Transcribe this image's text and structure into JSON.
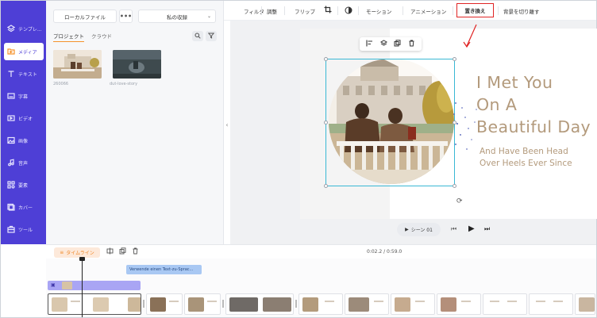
{
  "rail": {
    "items": [
      {
        "label": "テンプレ...",
        "icon": "layers-icon"
      },
      {
        "label": "メディア",
        "icon": "media-folder-icon"
      },
      {
        "label": "テキスト",
        "icon": "text-icon"
      },
      {
        "label": "字幕",
        "icon": "subtitle-icon"
      },
      {
        "label": "ビデオ",
        "icon": "video-icon"
      },
      {
        "label": "画像",
        "icon": "image-icon"
      },
      {
        "label": "音声",
        "icon": "music-icon"
      },
      {
        "label": "要素",
        "icon": "elements-icon"
      },
      {
        "label": "カバー",
        "icon": "cover-icon"
      },
      {
        "label": "ツール",
        "icon": "toolbox-icon"
      }
    ]
  },
  "panel": {
    "local_file": "ローカルファイル",
    "more": "•••",
    "collection": "私の収録",
    "tab_project": "プロジェクト",
    "tab_cloud": "クラウド",
    "files": [
      {
        "label": "260066"
      },
      {
        "label": "dut-love-story"
      }
    ]
  },
  "toolbar": {
    "filter": "フィルタ",
    "adjust": "調整",
    "flip": "フリップ",
    "motion": "モーション",
    "animation": "アニメーション",
    "replace": "置き換え",
    "detach_bg": "背景を切り離す"
  },
  "slide": {
    "title_lines": [
      "I Met You",
      "On A",
      "Beautiful Day"
    ],
    "sub_lines": [
      "And Have Been Head",
      "Over Heels Ever Since"
    ]
  },
  "player": {
    "scene": "シーン 01"
  },
  "timeline": {
    "label": "タイムライン",
    "time": "0:02.2 / 0:59.0",
    "tts_chip": "Verwende einen Text-zu-Sprac..."
  },
  "colors": {
    "rail": "#4e3fd6",
    "accent_orange": "#f5922b",
    "highlight_red": "#e02424",
    "title_gold": "#b39a7c",
    "selection": "#3ab8d4"
  }
}
